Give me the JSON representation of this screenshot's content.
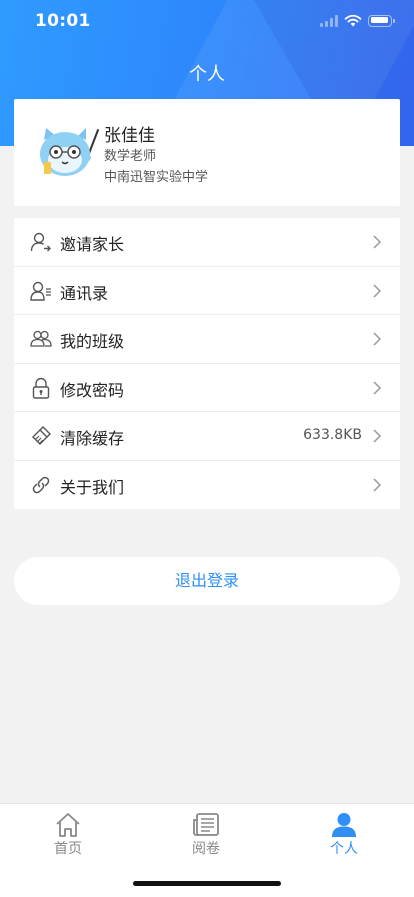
{
  "status_bar": {
    "time": "10:01"
  },
  "nav": {
    "title": "个人"
  },
  "profile": {
    "name": "张佳佳",
    "role": "数学老师",
    "school": "中南迅智实验中学",
    "avatar_icon": "cat-teacher-avatar-icon"
  },
  "menu": {
    "items": [
      {
        "label": "邀请家长",
        "icon": "invite-user-icon",
        "value": ""
      },
      {
        "label": "通讯录",
        "icon": "contacts-icon",
        "value": ""
      },
      {
        "label": "我的班级",
        "icon": "group-icon",
        "value": ""
      },
      {
        "label": "修改密码",
        "icon": "lock-icon",
        "value": ""
      },
      {
        "label": "清除缓存",
        "icon": "broom-icon",
        "value": "633.8KB"
      },
      {
        "label": "关于我们",
        "icon": "link-icon",
        "value": ""
      }
    ]
  },
  "logout": {
    "label": "退出登录"
  },
  "tabbar": {
    "tabs": [
      {
        "label": "首页",
        "icon": "home-icon",
        "active": false
      },
      {
        "label": "阅卷",
        "icon": "newspaper-icon",
        "active": false
      },
      {
        "label": "个人",
        "icon": "person-icon",
        "active": true
      }
    ]
  },
  "colors": {
    "accent": "#2f8ff5",
    "header_gradient_start": "#2f9bff",
    "header_gradient_end": "#3a6cf6",
    "background": "#f2f2f2"
  }
}
